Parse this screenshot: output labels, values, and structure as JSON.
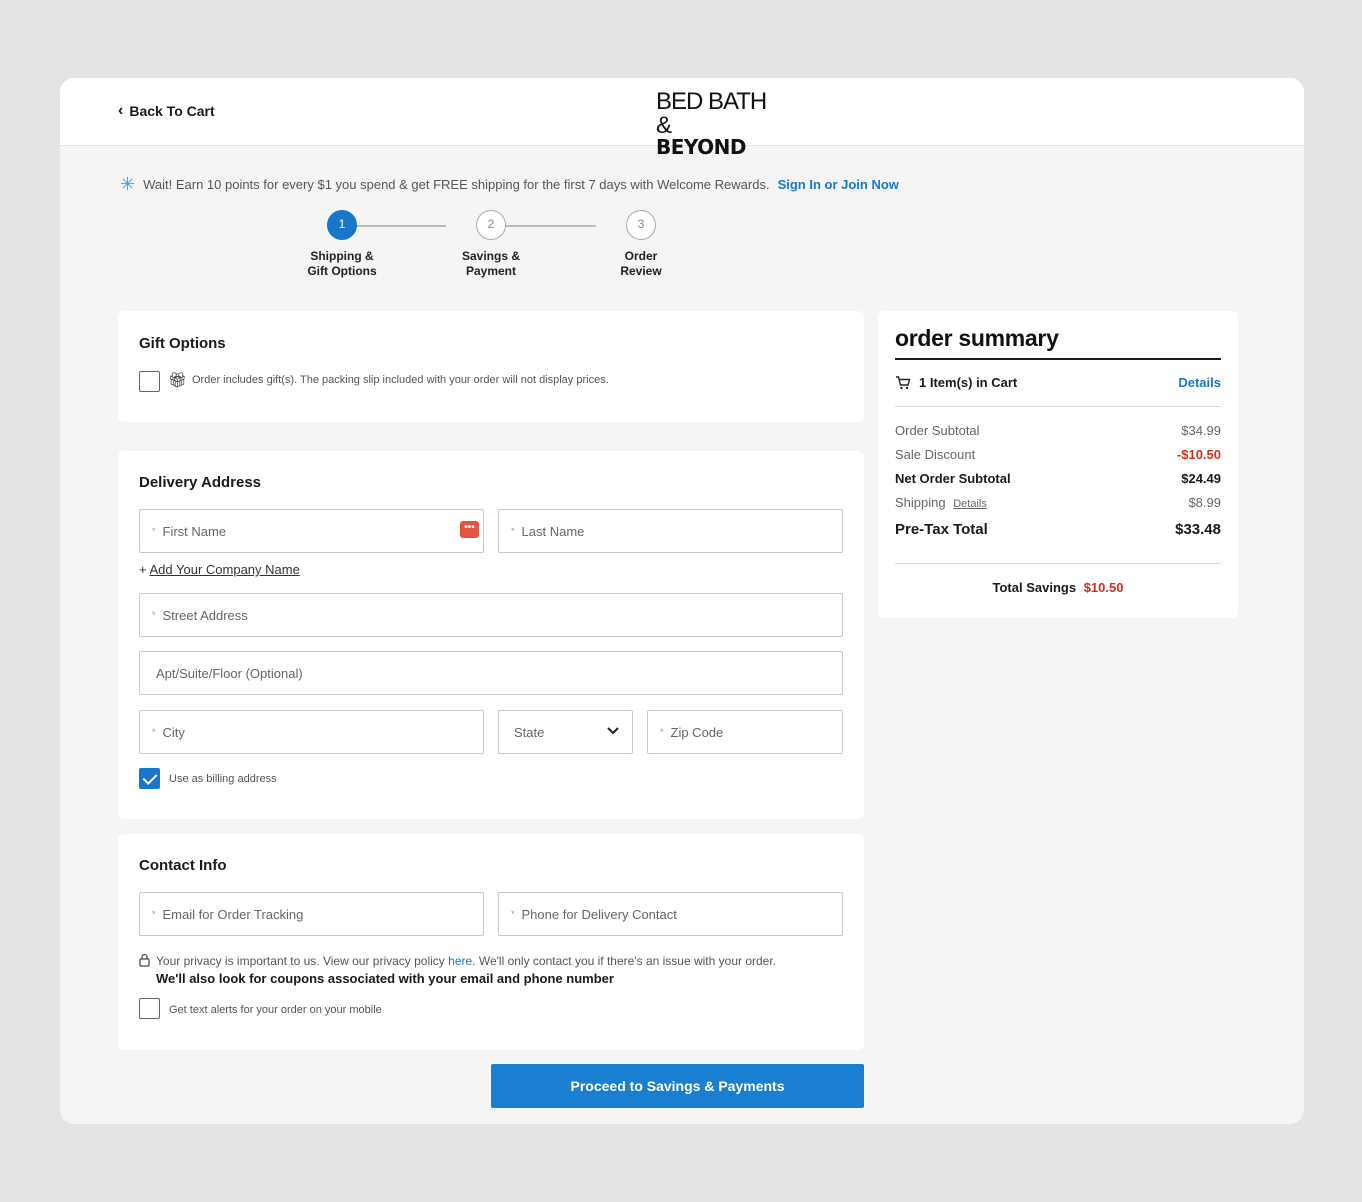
{
  "header": {
    "back_label": "Back To Cart",
    "logo_line1": "BED BATH &",
    "logo_line2": "BEYOND"
  },
  "promo": {
    "text": "Wait! Earn 10 points for every $1 you spend & get FREE shipping for the first 7 days with Welcome Rewards.",
    "link": "Sign In or Join Now"
  },
  "steps": [
    {
      "num": "1",
      "line1": "Shipping &",
      "line2": "Gift Options"
    },
    {
      "num": "2",
      "line1": "Savings &",
      "line2": "Payment"
    },
    {
      "num": "3",
      "line1": "Order",
      "line2": "Review"
    }
  ],
  "gift": {
    "title": "Gift Options",
    "checkbox_label": "Order includes gift(s). The packing slip included with your order will not display prices."
  },
  "delivery": {
    "title": "Delivery Address",
    "first_name": "First Name",
    "last_name": "Last Name",
    "add_company": "Add Your Company Name",
    "street": "Street Address",
    "apt": "Apt/Suite/Floor (Optional)",
    "city": "City",
    "state": "State",
    "zip": "Zip Code",
    "billing_label": "Use as billing address"
  },
  "contact": {
    "title": "Contact Info",
    "email": "Email for Order Tracking",
    "phone": "Phone for Delivery Contact",
    "privacy_text_a": "Your privacy is important to us. View our privacy policy",
    "privacy_link": "here",
    "privacy_text_b": ". We'll only contact you if there's an issue with your order.",
    "privacy_bold": "We'll also look for coupons associated with your email and phone number",
    "text_alerts": "Get text alerts for your order on your mobile"
  },
  "summary": {
    "title": "order summary",
    "items_in_cart": "1 Item(s) in Cart",
    "details_link": "Details",
    "order_subtotal_label": "Order Subtotal",
    "order_subtotal": "$34.99",
    "sale_discount_label": "Sale Discount",
    "sale_discount": "-$10.50",
    "net_subtotal_label": "Net Order Subtotal",
    "net_subtotal": "$24.49",
    "shipping_label": "Shipping",
    "shipping_details": "Details",
    "shipping": "$8.99",
    "pretax_label": "Pre-Tax Total",
    "pretax": "$33.48",
    "total_savings_label": "Total Savings",
    "total_savings": "$10.50"
  },
  "cta_label": "Proceed to Savings & Payments",
  "colors": {
    "accent": "#1877c9",
    "discount": "#d62d20"
  }
}
